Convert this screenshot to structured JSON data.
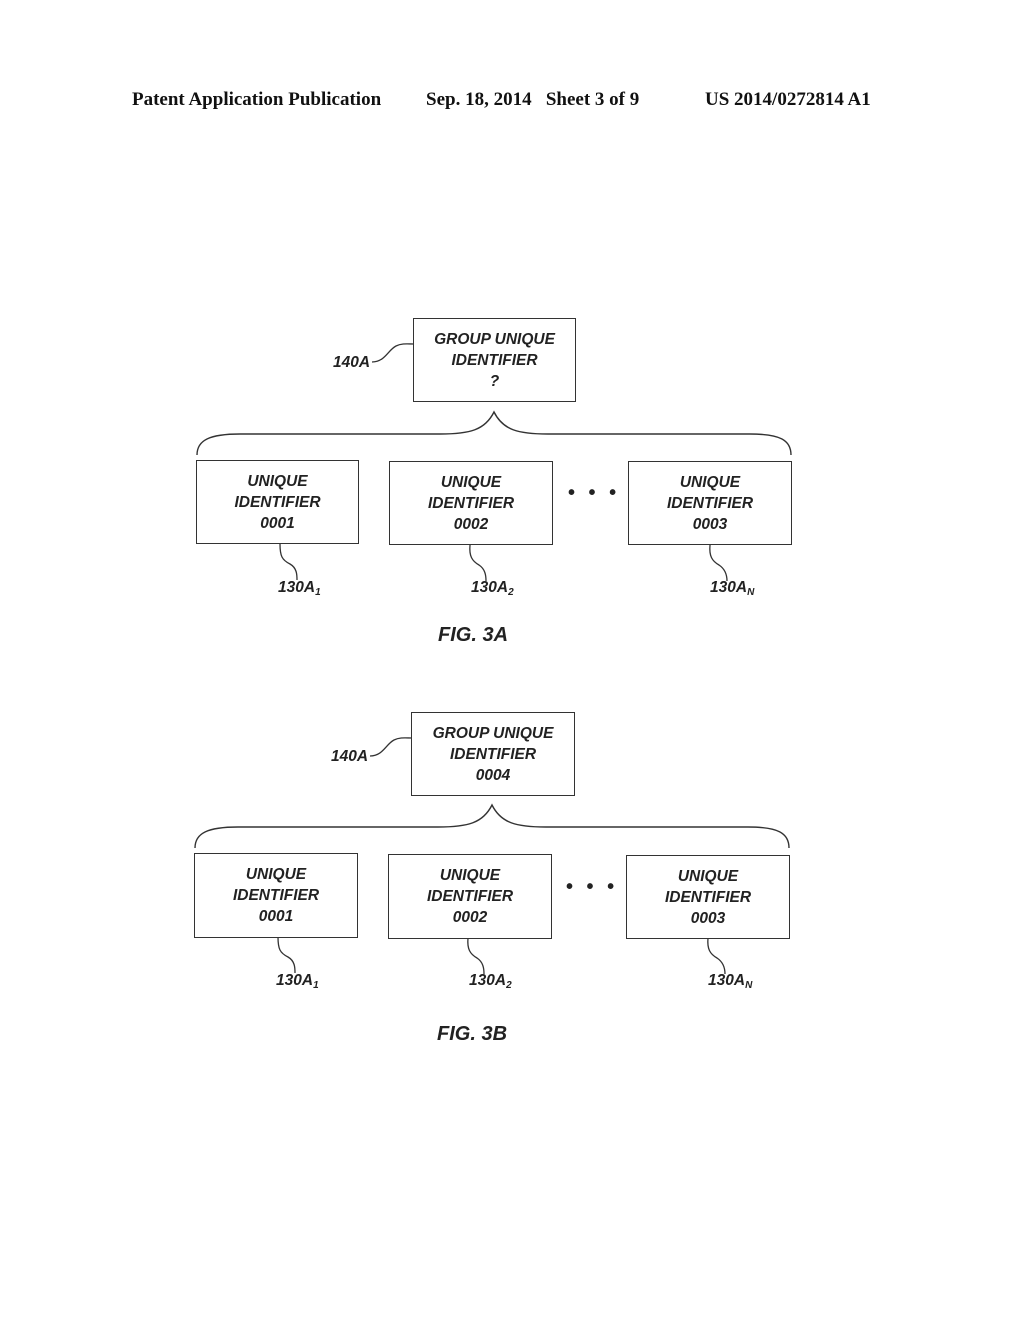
{
  "header": {
    "publication_type": "Patent Application Publication",
    "date_sheet": "Sep. 18, 2014   Sheet 3 of 9",
    "patent_number": "US 2014/0272814 A1"
  },
  "figures": [
    {
      "caption": "FIG. 3A",
      "group": {
        "ref": "140A",
        "lines": [
          "GROUP UNIQUE",
          "IDENTIFIER",
          "?"
        ]
      },
      "children": [
        {
          "ref_base": "130A",
          "ref_sub": "1",
          "lines": [
            "UNIQUE",
            "IDENTIFIER",
            "0001"
          ]
        },
        {
          "ref_base": "130A",
          "ref_sub": "2",
          "lines": [
            "UNIQUE",
            "IDENTIFIER",
            "0002"
          ]
        },
        {
          "ref_base": "130A",
          "ref_sub": "N",
          "lines": [
            "UNIQUE",
            "IDENTIFIER",
            "0003"
          ]
        }
      ],
      "ellipsis": "• • •"
    },
    {
      "caption": "FIG. 3B",
      "group": {
        "ref": "140A",
        "lines": [
          "GROUP UNIQUE",
          "IDENTIFIER",
          "0004"
        ]
      },
      "children": [
        {
          "ref_base": "130A",
          "ref_sub": "1",
          "lines": [
            "UNIQUE",
            "IDENTIFIER",
            "0001"
          ]
        },
        {
          "ref_base": "130A",
          "ref_sub": "2",
          "lines": [
            "UNIQUE",
            "IDENTIFIER",
            "0002"
          ]
        },
        {
          "ref_base": "130A",
          "ref_sub": "N",
          "lines": [
            "UNIQUE",
            "IDENTIFIER",
            "0003"
          ]
        }
      ],
      "ellipsis": "• • •"
    }
  ]
}
